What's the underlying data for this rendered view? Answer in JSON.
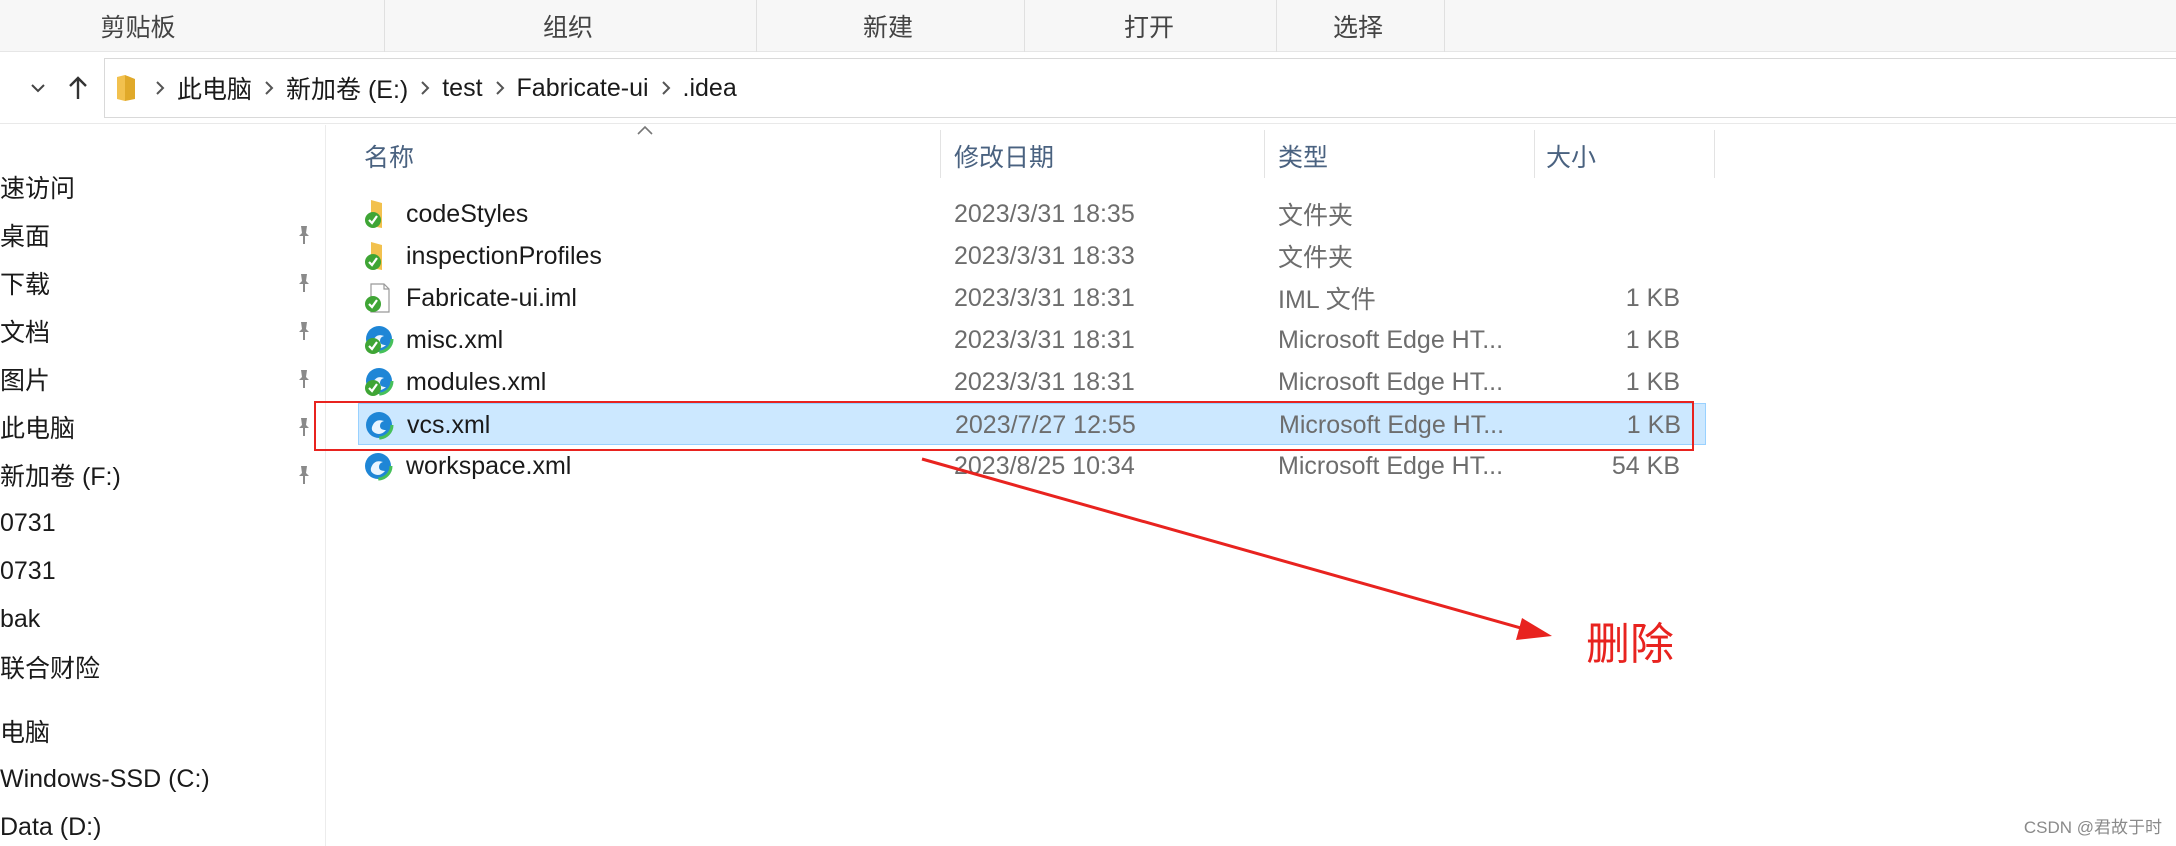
{
  "ribbon": {
    "groups": [
      "剪贴板",
      "组织",
      "新建",
      "打开",
      "选择"
    ]
  },
  "address_bar": {
    "breadcrumbs": [
      "此电脑",
      "新加卷 (E:)",
      "test",
      "Fabricate-ui",
      ".idea"
    ]
  },
  "nav_pane": {
    "items": [
      "速访问",
      "桌面",
      "下载",
      "文档",
      "图片",
      "此电脑",
      "新加卷 (F:)",
      "0731",
      "0731",
      "bak",
      "联合财险",
      "电脑",
      "Windows-SSD (C:)",
      "Data (D:)"
    ]
  },
  "columns": {
    "name": "名称",
    "date": "修改日期",
    "type": "类型",
    "size": "大小"
  },
  "files": [
    {
      "name": "codeStyles",
      "date": "2023/3/31 18:35",
      "type": "文件夹",
      "size": "",
      "icon": "folder-icon"
    },
    {
      "name": "inspectionProfiles",
      "date": "2023/3/31 18:33",
      "type": "文件夹",
      "size": "",
      "icon": "folder-icon"
    },
    {
      "name": "Fabricate-ui.iml",
      "date": "2023/3/31 18:31",
      "type": "IML 文件",
      "size": "1 KB",
      "icon": "document-icon"
    },
    {
      "name": "misc.xml",
      "date": "2023/3/31 18:31",
      "type": "Microsoft Edge HT...",
      "size": "1 KB",
      "icon": "edge-icon"
    },
    {
      "name": "modules.xml",
      "date": "2023/3/31 18:31",
      "type": "Microsoft Edge HT...",
      "size": "1 KB",
      "icon": "edge-icon"
    },
    {
      "name": "vcs.xml",
      "date": "2023/7/27 12:55",
      "type": "Microsoft Edge HT...",
      "size": "1 KB",
      "icon": "edge-icon"
    },
    {
      "name": "workspace.xml",
      "date": "2023/8/25 10:34",
      "type": "Microsoft Edge HT...",
      "size": "54 KB",
      "icon": "edge-icon"
    }
  ],
  "annotation": {
    "label": "删除",
    "color": "#e8231f"
  },
  "watermark": "CSDN @君故于时",
  "colors": {
    "selection_bg": "#cce8ff",
    "selection_border": "#99d1ff",
    "header_text": "#4a6280",
    "sync_green": "#3fa535"
  }
}
